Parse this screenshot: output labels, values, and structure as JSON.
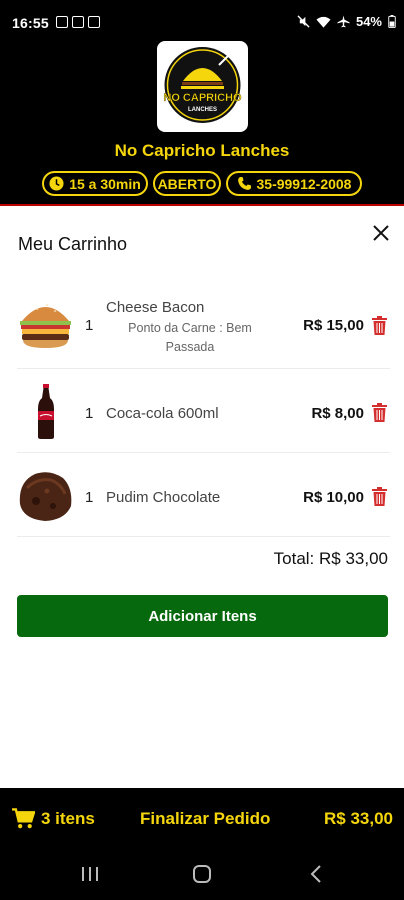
{
  "status": {
    "time": "16:55",
    "battery": "54%"
  },
  "store": {
    "name": "No Capricho Lanches",
    "logo_text": "NO CAPRICHO",
    "logo_subtext": "LANCHES",
    "delivery_time": "15 a 30min",
    "open_status": "ABERTO",
    "phone": "35-99912-2008"
  },
  "cart": {
    "title": "Meu Carrinho",
    "items": [
      {
        "qty": "1",
        "name": "Cheese Bacon",
        "note": "Ponto da Carne : Bem Passada",
        "price": "R$ 15,00",
        "image": "burger"
      },
      {
        "qty": "1",
        "name": "Coca-cola 600ml",
        "price": "R$ 8,00",
        "image": "soda-bottle"
      },
      {
        "qty": "1",
        "name": "Pudim Chocolate",
        "price": "R$ 10,00",
        "image": "chocolate-cake"
      }
    ],
    "total_label": "Total: R$ 33,00",
    "add_button_label": "Adicionar Itens"
  },
  "bottom_bar": {
    "items_count": "3 itens",
    "finish_label": "Finalizar Pedido",
    "total": "R$ 33,00"
  },
  "colors": {
    "accent_yellow": "#f5d60d",
    "button_green": "#07690d",
    "delete_red": "#d32f2f",
    "header_bg": "#000000"
  }
}
